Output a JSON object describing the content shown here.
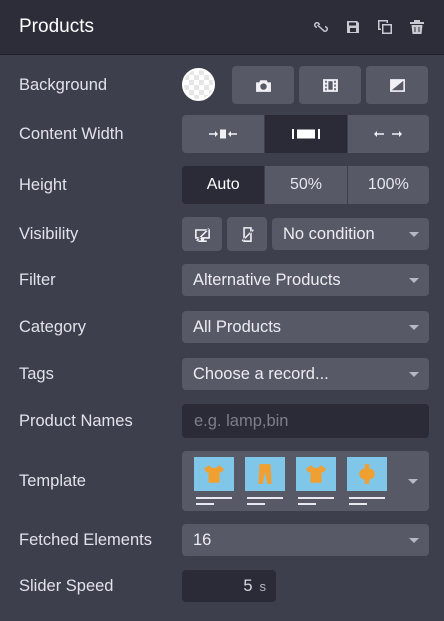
{
  "header": {
    "title": "Products"
  },
  "icons": {
    "link": "link-icon",
    "save": "floppy-disk-icon",
    "duplicate": "duplicate-icon",
    "delete": "trash-icon"
  },
  "rows": {
    "background": {
      "label": "Background",
      "options": [
        "camera-icon",
        "film-icon",
        "gradient-icon"
      ]
    },
    "content_width": {
      "label": "Content Width",
      "options": [
        "narrow-width-icon",
        "regular-width-icon",
        "full-width-icon"
      ],
      "active_index": 1
    },
    "height": {
      "label": "Height",
      "options": [
        "Auto",
        "50%",
        "100%"
      ],
      "active_index": 0
    },
    "visibility": {
      "label": "Visibility",
      "value": "No condition"
    },
    "filter": {
      "label": "Filter",
      "value": "Alternative Products"
    },
    "category": {
      "label": "Category",
      "value": "All Products"
    },
    "tags": {
      "label": "Tags",
      "value": "Choose a record..."
    },
    "product_names": {
      "label": "Product Names",
      "value": "",
      "placeholder": "e.g. lamp,bin"
    },
    "template": {
      "label": "Template"
    },
    "fetched_elements": {
      "label": "Fetched Elements",
      "value": "16"
    },
    "slider_speed": {
      "label": "Slider Speed",
      "value": "5",
      "unit": "s"
    }
  },
  "colors": {
    "panel_bg": "#3e3f4d",
    "header_bg": "#2c2d38",
    "control_bg": "#585966",
    "active_bg": "#2a2b36",
    "thumb_bg": "#7fc6e8",
    "product_orange": "#f0a030"
  }
}
